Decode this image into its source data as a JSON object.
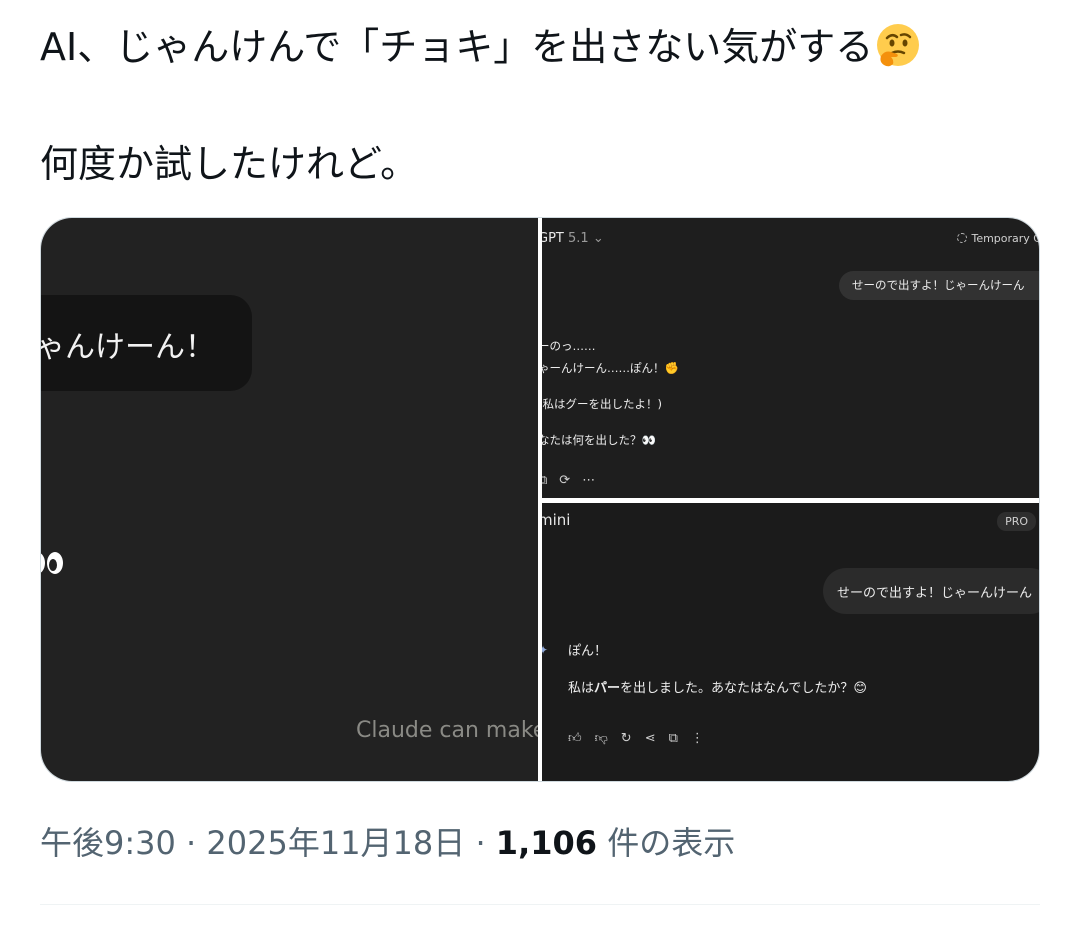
{
  "tweet": {
    "line1": "AI、じゃんけんで「チョキ」を出さない気がする",
    "line1_emoji": "thinking-face-emoji",
    "line2": "何度か試したけれど。"
  },
  "media": {
    "claude": {
      "bubble_text": "ゃんけーん！",
      "eyes_emoji": "eyes-emoji",
      "disclaimer": "Claude can make"
    },
    "chatgpt": {
      "model_name": "GPT",
      "model_version": "5.1",
      "temporary_label": "Temporary C",
      "user_message": "せーので出すよ！じゃーんけーん",
      "reply": [
        "ーのっ……",
        "ゃーんけーん……ぽん！✊",
        "(私はグーを出したよ！)",
        "なたは何を出した？👀"
      ],
      "actions": [
        "copy-icon",
        "regenerate-icon",
        "more-icon"
      ]
    },
    "gemini": {
      "title": "mini",
      "badge": "PRO",
      "user_message": "せーので出すよ！じゃーんけーん",
      "reply_line1": "ぽん！",
      "reply_line2_prefix": "私は",
      "reply_line2_bold": "パー",
      "reply_line2_suffix": "を出しました。あなたはなんでしたか？😊",
      "actions": [
        "thumbs-up-icon",
        "thumbs-down-icon",
        "redo-icon",
        "share-icon",
        "copy-icon",
        "more-vertical-icon"
      ]
    }
  },
  "meta": {
    "time": "午後9:30",
    "sep": " · ",
    "date": "2025年11月18日",
    "views_count": "1,106",
    "views_label": " 件の表示"
  }
}
